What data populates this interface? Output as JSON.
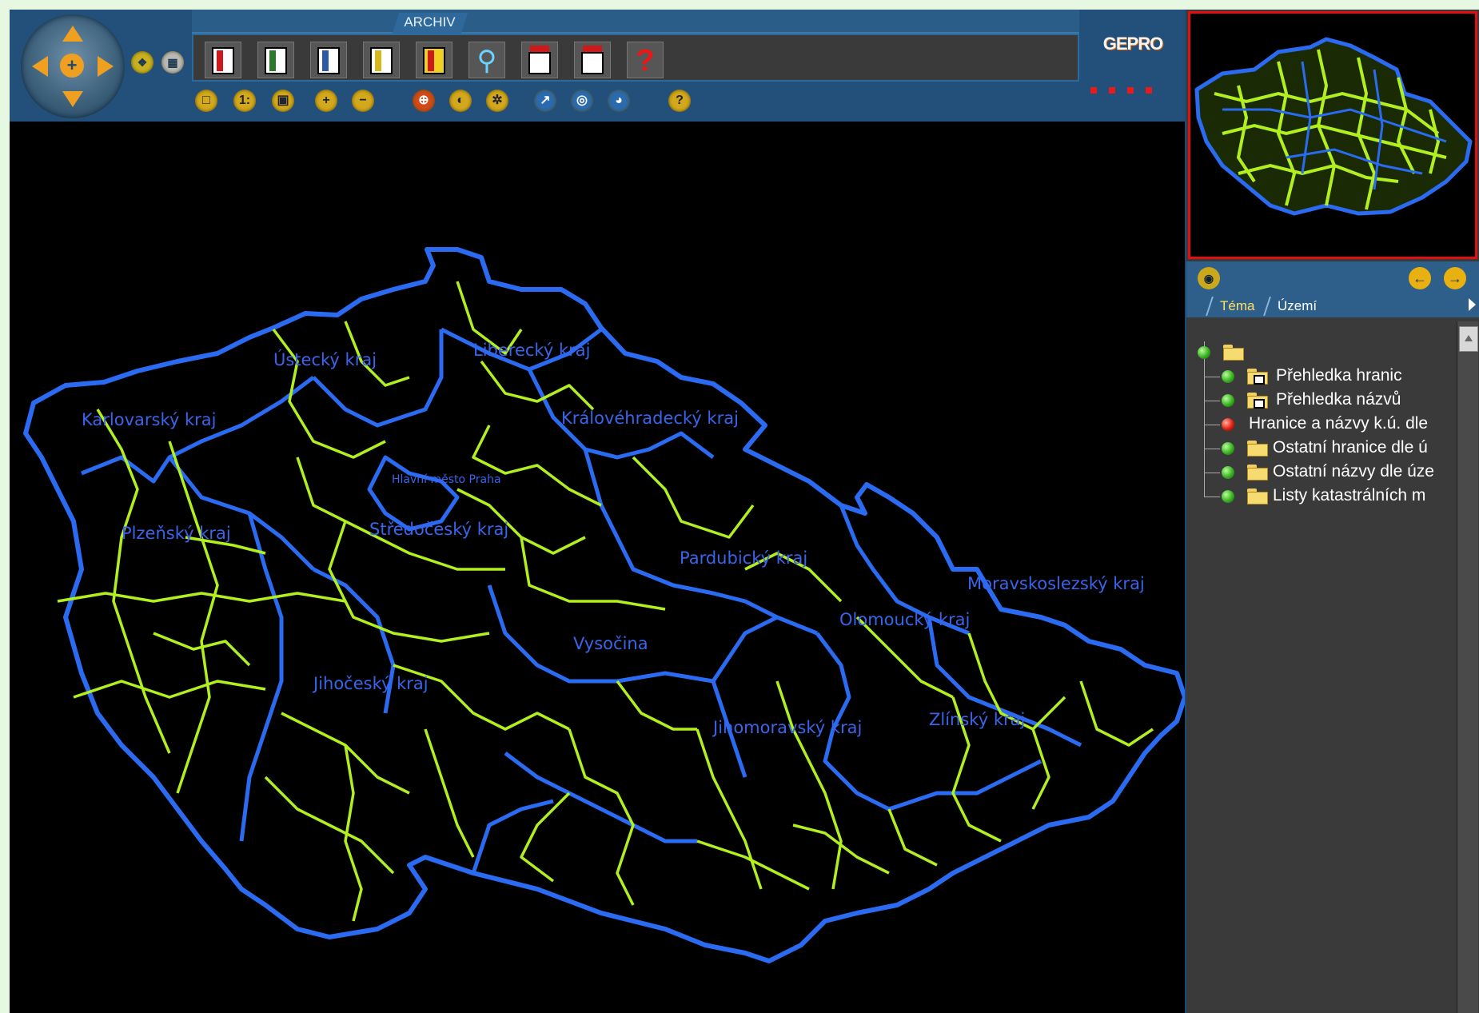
{
  "toolbar": {
    "tab_label": "ARCHIV",
    "logo_text": "GEPRO",
    "big_icons": [
      "select-add-icon",
      "select-edit-icon",
      "pan-select-icon",
      "export-icon",
      "erase-icon",
      "zoom-magnifier-icon",
      "print-icon",
      "print-settings-icon",
      "help-icon"
    ],
    "small_icons": [
      {
        "name": "zoom-extent-icon",
        "glyph": "□"
      },
      {
        "name": "scale-1-to-icon",
        "glyph": "1:"
      },
      {
        "name": "zoom-window-icon",
        "glyph": "▣"
      },
      {
        "name": "zoom-in-icon",
        "glyph": "+"
      },
      {
        "name": "zoom-out-icon",
        "glyph": "−"
      },
      {
        "name": "target-icon",
        "glyph": "⊕"
      },
      {
        "name": "clear-icon",
        "glyph": "◐"
      },
      {
        "name": "tools-icon",
        "glyph": "✲"
      },
      {
        "name": "link-icon",
        "glyph": "↗"
      },
      {
        "name": "lifebuoy-icon",
        "glyph": "◎"
      },
      {
        "name": "globe-icon",
        "glyph": "◕"
      },
      {
        "name": "small-help-icon",
        "glyph": "?"
      }
    ]
  },
  "map": {
    "region_labels": [
      "Karlovarský kraj",
      "Ústecký kraj",
      "Liberecký kraj",
      "Královéhradecký kraj",
      "Hlavní město Praha",
      "Plzeňský kraj",
      "Středočeský kraj",
      "Pardubický kraj",
      "Moravskoslezský kraj",
      "Olomoucký kraj",
      "Vysočina",
      "Jihočeský kraj",
      "Jihomoravský kraj",
      "Zlínský kraj"
    ],
    "colors": {
      "border": "#2a6bf2",
      "district": "#b2ef1e",
      "background": "#000000",
      "label": "#3a64ea"
    }
  },
  "panel": {
    "tabs": [
      "Téma",
      "Území"
    ],
    "layers": [
      {
        "label": "",
        "status": "green",
        "type": "folder-root"
      },
      {
        "label": "Přehledka hranic",
        "status": "green",
        "type": "folder-boxed"
      },
      {
        "label": "Přehledka názvů",
        "status": "green",
        "type": "folder-boxed"
      },
      {
        "label": "Hranice a názvy k.ú. dle",
        "status": "red",
        "type": "none"
      },
      {
        "label": "Ostatní hranice dle ú",
        "status": "green",
        "type": "folder"
      },
      {
        "label": "Ostatní názvy dle úze",
        "status": "green",
        "type": "folder"
      },
      {
        "label": "Listy katastrálních m",
        "status": "green",
        "type": "folder"
      }
    ]
  }
}
